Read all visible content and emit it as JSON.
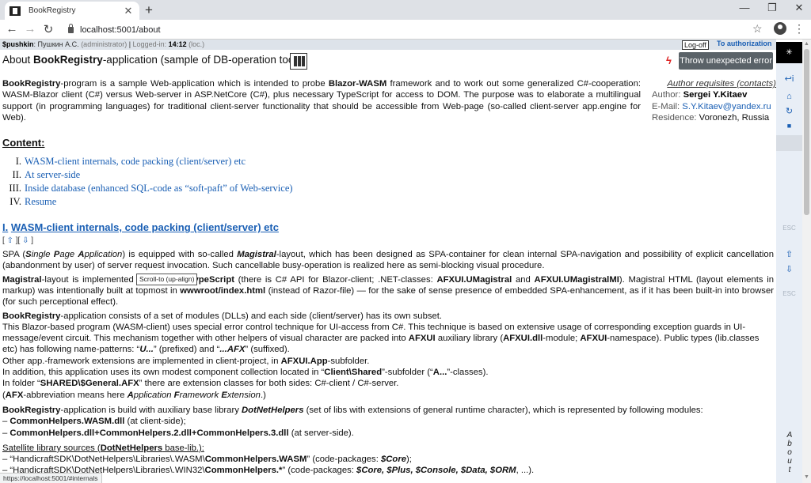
{
  "browser": {
    "tab_title": "BookRegistry",
    "tab_close": "✕",
    "new_tab": "+",
    "url": "localhost:5001/about",
    "btn_minimize": "—",
    "btn_restore": "❐",
    "btn_close": "✕",
    "back": "←",
    "forward": "→",
    "reload": "↻",
    "star": "☆",
    "menu": "⋮"
  },
  "userbar": {
    "login": "$pushkin",
    "name": "Пушкин А.С.",
    "role": "(administrator)",
    "logged_label": "Logged-in:",
    "logged_time": "14:12",
    "loc": "(loc.)",
    "logoff": "Log-off",
    "to_authorization": "To authorization"
  },
  "header": {
    "title_prefix": "About ",
    "title_bold": "BookRegistry",
    "title_suffix": "-application (sample of DB-operation tool)",
    "throw_button": "Throw unexpected error",
    "lightning": "ϟ"
  },
  "intro": {
    "p1_bold1": "BookRegistry",
    "p1_t1": "-program is a sample Web-application which is intended to probe ",
    "p1_bold2": "Blazor-WASM",
    "p1_t2": " framework and to work out some generalized C#-cooperation: WASM-Blazor client (C#) versus Web-server in ASP.NetCore (C#), plus necessary TypeScript for access to DOM. The purpose was to elaborate a multilingual support (in programming languages) for traditional client-server functionality that should be accessible from Web-page (so-called client-server app.engine for Web)."
  },
  "author": {
    "heading": "Author requisites (contacts):",
    "author_label": "Author: ",
    "author_name": "Sergei Y.Kitaev",
    "email_label": "E-Mail: ",
    "email": "S.Y.Kitaev@yandex.ru",
    "residence_label": "Residence: ",
    "residence": "Voronezh, Russia"
  },
  "contents": {
    "heading": "Content:",
    "items": [
      {
        "num": "I.",
        "label": "WASM-client internals, code packing (client/server) etc"
      },
      {
        "num": "II.",
        "label": "At server-side"
      },
      {
        "num": "III.",
        "label": "Inside database (enhanced SQL-code as “soft-paft” of Web-service)"
      },
      {
        "num": "IV.",
        "label": "Resume"
      }
    ]
  },
  "section1": {
    "num": "I.",
    "title": "WASM-client internals, code packing (client/server) etc",
    "nav_open": "[",
    "nav_up": "⇧",
    "nav_mid": "][",
    "nav_down": "⇩",
    "nav_close": "]",
    "tooltip": "Scroll-to (up-align)",
    "spa_t1": "SPA (",
    "spa_i1": "S",
    "spa_i2": "ingle ",
    "spa_i3": "P",
    "spa_i4": "age ",
    "spa_i5": "A",
    "spa_i6": "pplication",
    "spa_t2": ") is equipped with so-called ",
    "spa_b1": "Magistral",
    "spa_t3": "-layout, which has been designed as SPA-container for clean internal SPA-navigation and possibility of explicit cancellation (abandonment by user) of server request invocation. Such cancellable busy-operation is realized here as semi-blocking visual procedure.",
    "mag_b1": "Magistral",
    "mag_t1": "-layout is implemented with help of ",
    "mag_b2": "TypeScript",
    "mag_t2": " (there is C# API for Blazor-client; .NET-classes: ",
    "mag_b3": "AFXUI.UMagistral",
    "mag_t3": " and ",
    "mag_b4": "AFXUI.UMagistralMI",
    "mag_t4": "). Magistral HTML (layout elements in markup) was intentionally built at topmost in ",
    "mag_b5": "wwwroot/index.html",
    "mag_t5": " (instead of Razor-file) — for the sake of sense presence of embedded SPA-enhancement, as if it has been built-in into browser (for such perceptional effect).",
    "br_b1": "BookRegistry",
    "br_t1": "-application consists of a set of modules (DLLs) and each side (client/server) has its own subset.",
    "br_t2": "This Blazor-based program (WASM-client) uses special error control technique for UI-access from C#. This technique is based on extensive usage of corresponding exception guards in UI-message/event circuit. This mechanism together with other helpers of visual character are packed into ",
    "br_b2": "AFXUI",
    "br_t3": " auxiliary library (",
    "br_b3": "AFXUI.dll",
    "br_t4": "-module; ",
    "br_b4": "AFXUI",
    "br_t5": "-namespace). Public types (lib.classes etc) has following name-patterns: “",
    "br_bi1": "U...",
    "br_t6": "” (prefixed) and “",
    "br_bi2": "...AFX",
    "br_t7": "” (suffixed).",
    "br_t8": "Other app.-framework extensions are implemented in client-project, in ",
    "br_b5": "AFXUI.App",
    "br_t9": "-subfolder.",
    "br_t10": "In addition, this application uses its own modest component collection located in “",
    "br_b6": "Client\\Shared",
    "br_t11": "”-subfolder (“",
    "br_b7": "A...",
    "br_t12": "”-classes).",
    "br_t13": "In folder “",
    "br_b8": "SHARED\\$General.AFX",
    "br_t14": "” there are extension classes for both sides: C#-client / C#-server.",
    "br_t15": "(",
    "br_b9": "AFX",
    "br_t16": "-abbreviation means here ",
    "br_i1": "A",
    "br_i2": "pplication ",
    "br_i3": "F",
    "br_i4": "ramework ",
    "br_i5": "E",
    "br_i6": "xtension",
    "br_t17": ".)",
    "dn_b1": "BookRegistry",
    "dn_t1": "-application is build with auxiliary base library ",
    "dn_bi1": "DotNetHelpers",
    "dn_t2": " (set of libs with extensions of general runtime character), which is represented by following modules:",
    "dn_l1_pre": "– ",
    "dn_l1_b": "CommonHelpers.WASM.dll",
    "dn_l1_t": " (at client-side);",
    "dn_l2_pre": "– ",
    "dn_l2_b": "CommonHelpers.dll+CommonHelpers.2.dll+CommonHelpers.3.dll",
    "dn_l2_t": " (at server-side).",
    "sat_t1": "Satellite library sources (",
    "sat_b1": "DotNetHelpers",
    "sat_t2": " base-lib.):",
    "sat_l1_pre": "– “HandicraftSDK\\DotNetHelpers\\Libraries\\.WASM\\",
    "sat_l1_b": "CommonHelpers.WASM",
    "sat_l1_t": "” (code-packages: ",
    "sat_l1_bi": "$Core",
    "sat_l1_end": ");",
    "sat_l2_pre": "– “HandicraftSDK\\DotNetHelpers\\Libraries\\.WIN32\\",
    "sat_l2_b": "CommonHelpers.*",
    "sat_l2_t": "” (code-packages: ",
    "sat_l2_bi": "$Core, $Plus, $Console, $Data, $ORM",
    "sat_l2_end": ", ...)."
  },
  "sidepanel": {
    "top": "✳",
    "lang": "↩i",
    "home": "⌂",
    "refresh": "↻",
    "square": "■",
    "esc1": "ESC",
    "up": "⇧",
    "down": "⇩",
    "esc2": "ESC",
    "about": "About"
  },
  "statusbar": "https://localhost:5001/#internals"
}
